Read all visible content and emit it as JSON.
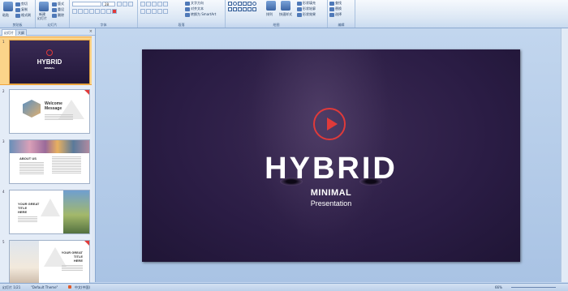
{
  "ribbon": {
    "groups": [
      {
        "name": "clipboard",
        "label": "剪贴板"
      },
      {
        "name": "slides",
        "label": "幻灯片"
      },
      {
        "name": "font",
        "label": "字体"
      },
      {
        "name": "paragraph",
        "label": "段落"
      },
      {
        "name": "drawing",
        "label": "绘图"
      },
      {
        "name": "editing",
        "label": "编辑"
      }
    ],
    "clipboard": {
      "paste": "粘贴",
      "cut": "剪切",
      "copy": "复制",
      "format_painter": "格式刷"
    },
    "slides": {
      "new_slide": "新建",
      "new_slide2": "幻灯片",
      "layout": "版式",
      "reset": "重设",
      "delete": "删除"
    },
    "font": {
      "font_name": "",
      "font_size": "28"
    },
    "paragraph": {
      "text_direction": "文字方向",
      "align_text": "对齐文本",
      "smartart": "转换为 SmartArt"
    },
    "drawing": {
      "arrange": "排列",
      "quick_styles": "快速样式",
      "shape_fill": "形状填充",
      "shape_outline": "形状轮廓",
      "shape_effects": "形状效果"
    },
    "editing": {
      "find": "查找",
      "replace": "替换",
      "select": "选择"
    }
  },
  "pane": {
    "tab_slides": "幻灯片",
    "tab_outline": "大纲",
    "close": "×",
    "thumbs": [
      {
        "num": "1",
        "title": "HYBRID",
        "sub": "MINIMAL"
      },
      {
        "num": "2",
        "title": "Welcome",
        "title2": "Message"
      },
      {
        "num": "3",
        "title": "ABOUT US"
      },
      {
        "num": "4",
        "title": "YOUR GREAT",
        "title2": "TITLE",
        "title3": "HERE"
      },
      {
        "num": "5",
        "title": "YOUR GREAT",
        "title2": "TITLE",
        "title3": "HERE"
      }
    ]
  },
  "slide": {
    "title": "HYBRID",
    "subtitle": "MINIMAL",
    "subtitle2": "Presentation",
    "accent": "#e03a3a",
    "background": "#2a1c44"
  },
  "status": {
    "slide_count": "幻灯片 1/21",
    "theme": "\"Default Theme\"",
    "input_method": "中文(中国)",
    "zoom": "66%"
  }
}
